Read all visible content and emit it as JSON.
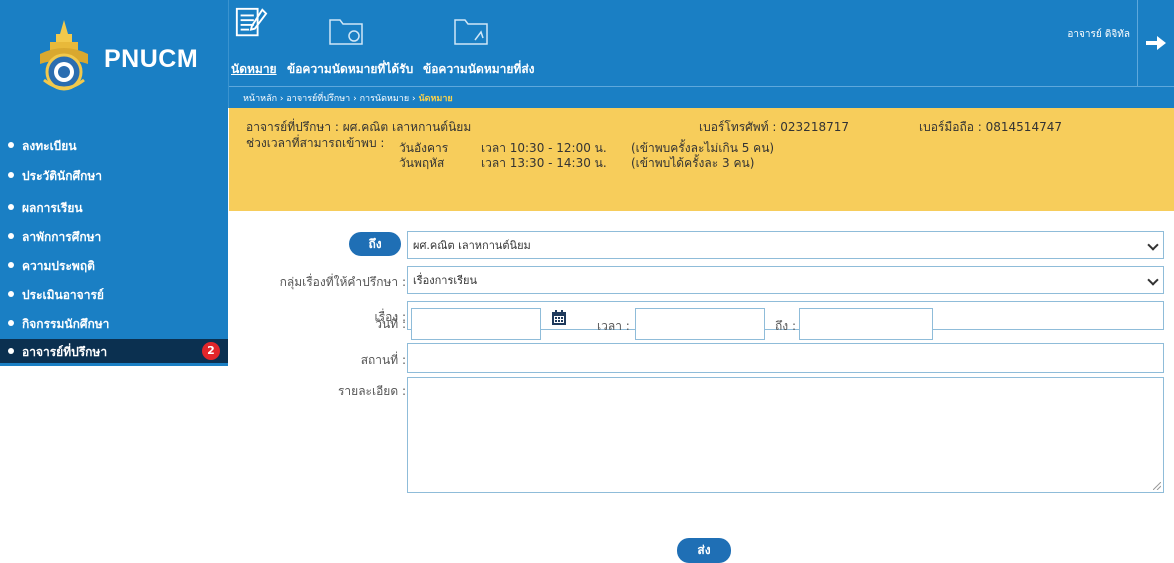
{
  "brand": {
    "name": "PNUCM"
  },
  "nav": {
    "tabs": [
      {
        "label": "นัดหมาย",
        "icon": "notepad-pen-icon",
        "active": true
      },
      {
        "label": "ข้อความนัดหมายที่ได้รับ",
        "icon": "folder-inbox-icon",
        "active": false
      },
      {
        "label": "ข้อความนัดหมายที่ส่ง",
        "icon": "folder-sent-icon",
        "active": false
      }
    ],
    "user_name": "อาจารย์ ดิจิทัล",
    "logout_icon": "arrow-right-icon"
  },
  "breadcrumb": {
    "items": [
      "หน้าหลัก",
      "อาจารย์ที่ปรึกษา",
      "การนัดหมาย"
    ],
    "current": "นัดหมาย",
    "separator": "›"
  },
  "sidebar": {
    "items": [
      {
        "label": "ลงทะเบียน"
      },
      {
        "label": "ประวัตินักศึกษา"
      },
      {
        "label": "ผลการเรียน"
      },
      {
        "label": "ลาพักการศึกษา"
      },
      {
        "label": "ความประพฤติ"
      },
      {
        "label": "ประเมินอาจารย์"
      },
      {
        "label": "กิจกรรมนักศึกษา"
      },
      {
        "label": "อาจารย์ที่ปรึกษา",
        "badge": "2",
        "active": true
      }
    ]
  },
  "info": {
    "advisor": "อาจารย์ที่ปรึกษา : ผศ.คณิต เลาหกานต์นิยม",
    "phone": "เบอร์โทรศัพท์ : 023218717",
    "mobile": "เบอร์มือถือ : 0814514747",
    "hours_label": "ช่วงเวลาที่สามารถเข้าพบ :",
    "slots": [
      {
        "day": "วันอังคาร",
        "time": "เวลา 10:30 - 12:00 น.",
        "note": "(เข้าพบครั้งละไม่เกิน 5 คน)"
      },
      {
        "day": "วันพฤหัส",
        "time": "เวลา 13:30 - 14:30 น.",
        "note": "(เข้าพบได้ครั้งละ 3 คน)"
      }
    ]
  },
  "form": {
    "to_button": "ถึง",
    "to_value": "ผศ.คณิต เลาหกานต์นิยม",
    "topic_label": "กลุ่มเรื่องที่ให้คำปรึกษา :",
    "topic_value": "เรื่องการเรียน",
    "subject_label": "เรื่อง :",
    "subject_value": "",
    "date_label": "วันที่ :",
    "date_value": "",
    "time_label": "เวลา :",
    "time_value": "",
    "until_label": "ถึง :",
    "until_value": "",
    "place_label": "สถานที่ :",
    "place_value": "",
    "detail_label": "รายละเอียด :",
    "detail_value": "",
    "send_button": "ส่ง"
  },
  "colors": {
    "primary": "#1a7fc4",
    "banner": "#f7cd5b",
    "active_side": "#0b3050",
    "badge": "#e1262b",
    "button": "#1f6fb5"
  }
}
